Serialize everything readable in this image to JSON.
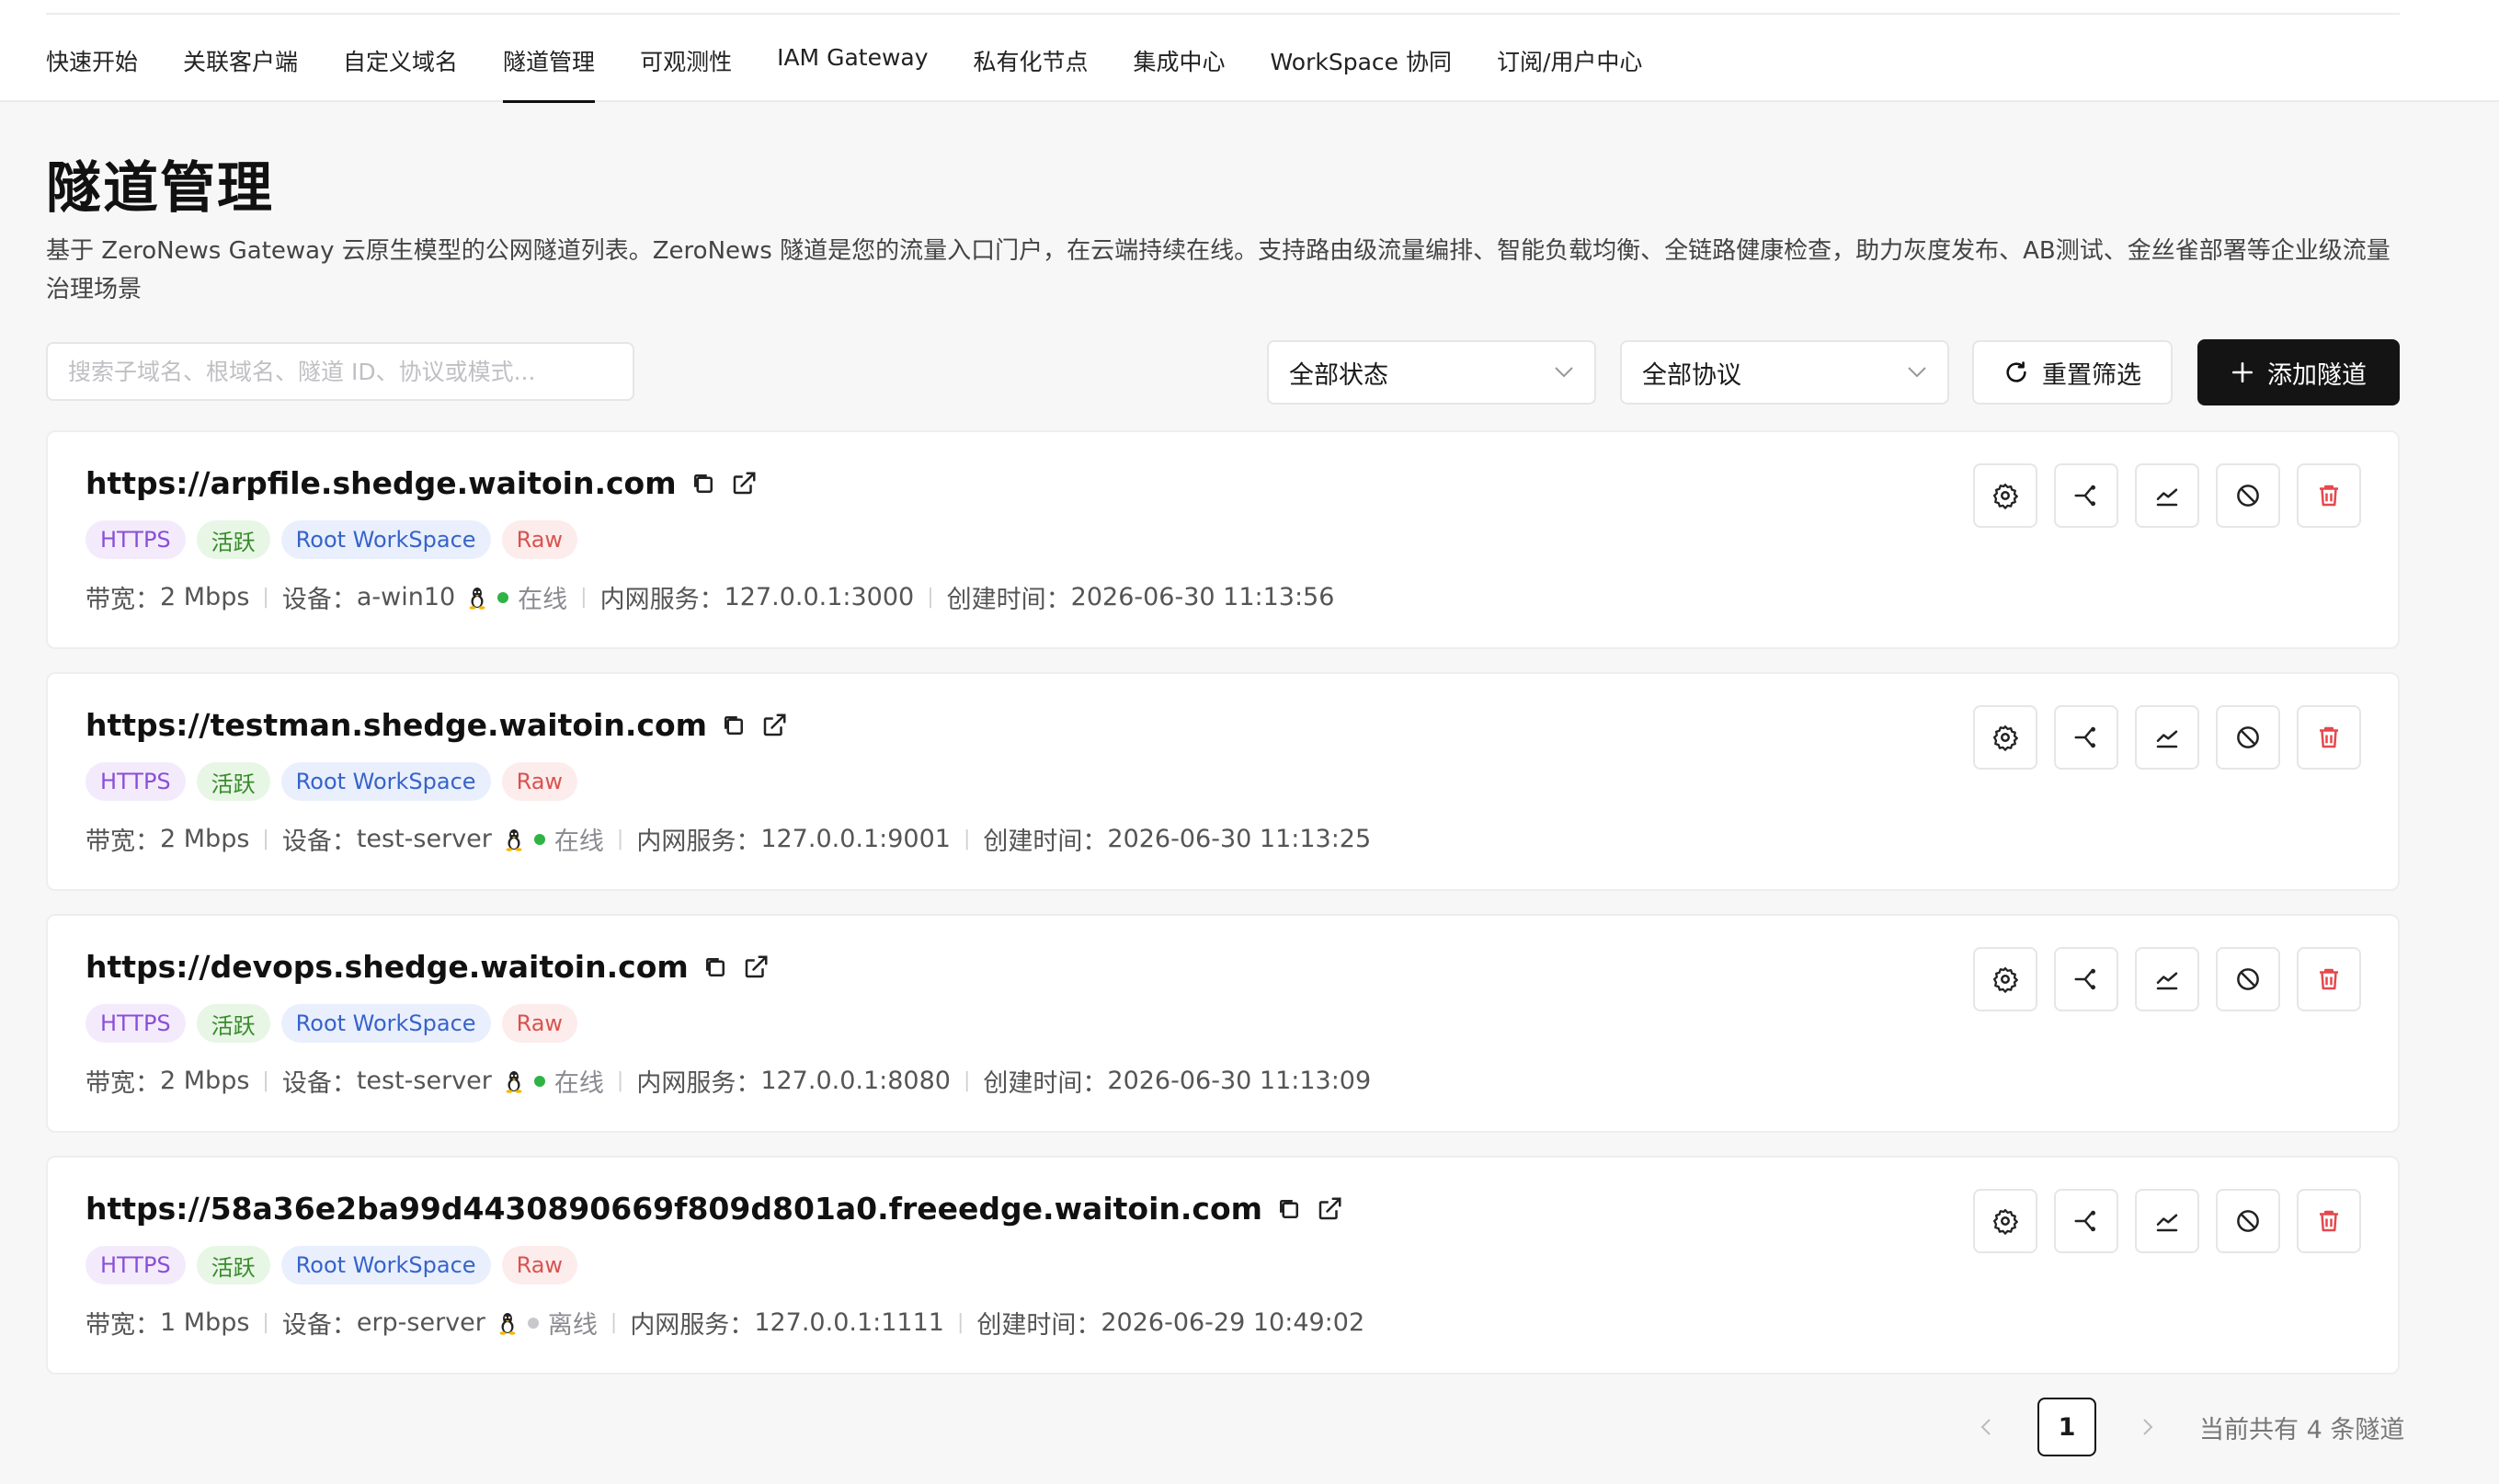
{
  "nav": {
    "tabs": [
      {
        "label": "快速开始"
      },
      {
        "label": "关联客户端"
      },
      {
        "label": "自定义域名"
      },
      {
        "label": "隧道管理"
      },
      {
        "label": "可观测性"
      },
      {
        "label": "IAM Gateway"
      },
      {
        "label": "私有化节点"
      },
      {
        "label": "集成中心"
      },
      {
        "label": "WorkSpace 协同"
      },
      {
        "label": "订阅/用户中心"
      }
    ],
    "active_index": 3
  },
  "page": {
    "title": "隧道管理",
    "description": "基于 ZeroNews Gateway 云原生模型的公网隧道列表。ZeroNews 隧道是您的流量入口门户，在云端持续在线。支持路由级流量编排、智能负载均衡、全链路健康检查，助力灰度发布、AB测试、金丝雀部署等企业级流量治理场景"
  },
  "toolbar": {
    "search_placeholder": "搜索子域名、根域名、隧道 ID、协议或模式...",
    "status_select": "全部状态",
    "protocol_select": "全部协议",
    "reset_label": "重置筛选",
    "add_label": "添加隧道"
  },
  "labels": {
    "bandwidth": "带宽：",
    "device": "设备：",
    "service": "内网服务：",
    "created": "创建时间："
  },
  "tunnels": [
    {
      "url": "https://arpfile.shedge.waitoin.com",
      "tags": {
        "protocol": "HTTPS",
        "state": "活跃",
        "workspace": "Root WorkSpace",
        "mode": "Raw"
      },
      "bandwidth": "2 Mbps",
      "device": "a-win10",
      "status": "在线",
      "online": true,
      "service": "127.0.0.1:3000",
      "created": "2026-06-30 11:13:56"
    },
    {
      "url": "https://testman.shedge.waitoin.com",
      "tags": {
        "protocol": "HTTPS",
        "state": "活跃",
        "workspace": "Root WorkSpace",
        "mode": "Raw"
      },
      "bandwidth": "2 Mbps",
      "device": "test-server",
      "status": "在线",
      "online": true,
      "service": "127.0.0.1:9001",
      "created": "2026-06-30 11:13:25"
    },
    {
      "url": "https://devops.shedge.waitoin.com",
      "tags": {
        "protocol": "HTTPS",
        "state": "活跃",
        "workspace": "Root WorkSpace",
        "mode": "Raw"
      },
      "bandwidth": "2 Mbps",
      "device": "test-server",
      "status": "在线",
      "online": true,
      "service": "127.0.0.1:8080",
      "created": "2026-06-30 11:13:09"
    },
    {
      "url": "https://58a36e2ba99d4430890669f809d801a0.freeedge.waitoin.com",
      "tags": {
        "protocol": "HTTPS",
        "state": "活跃",
        "workspace": "Root WorkSpace",
        "mode": "Raw"
      },
      "bandwidth": "1 Mbps",
      "device": "erp-server",
      "status": "离线",
      "online": false,
      "service": "127.0.0.1:1111",
      "created": "2026-06-29 10:49:02"
    }
  ],
  "pagination": {
    "current": "1",
    "total_text": "当前共有 4 条隧道"
  },
  "colors": {
    "primary": "#141414",
    "online": "#2fb344",
    "offline": "#c8c8cc",
    "danger": "#e5484d"
  }
}
